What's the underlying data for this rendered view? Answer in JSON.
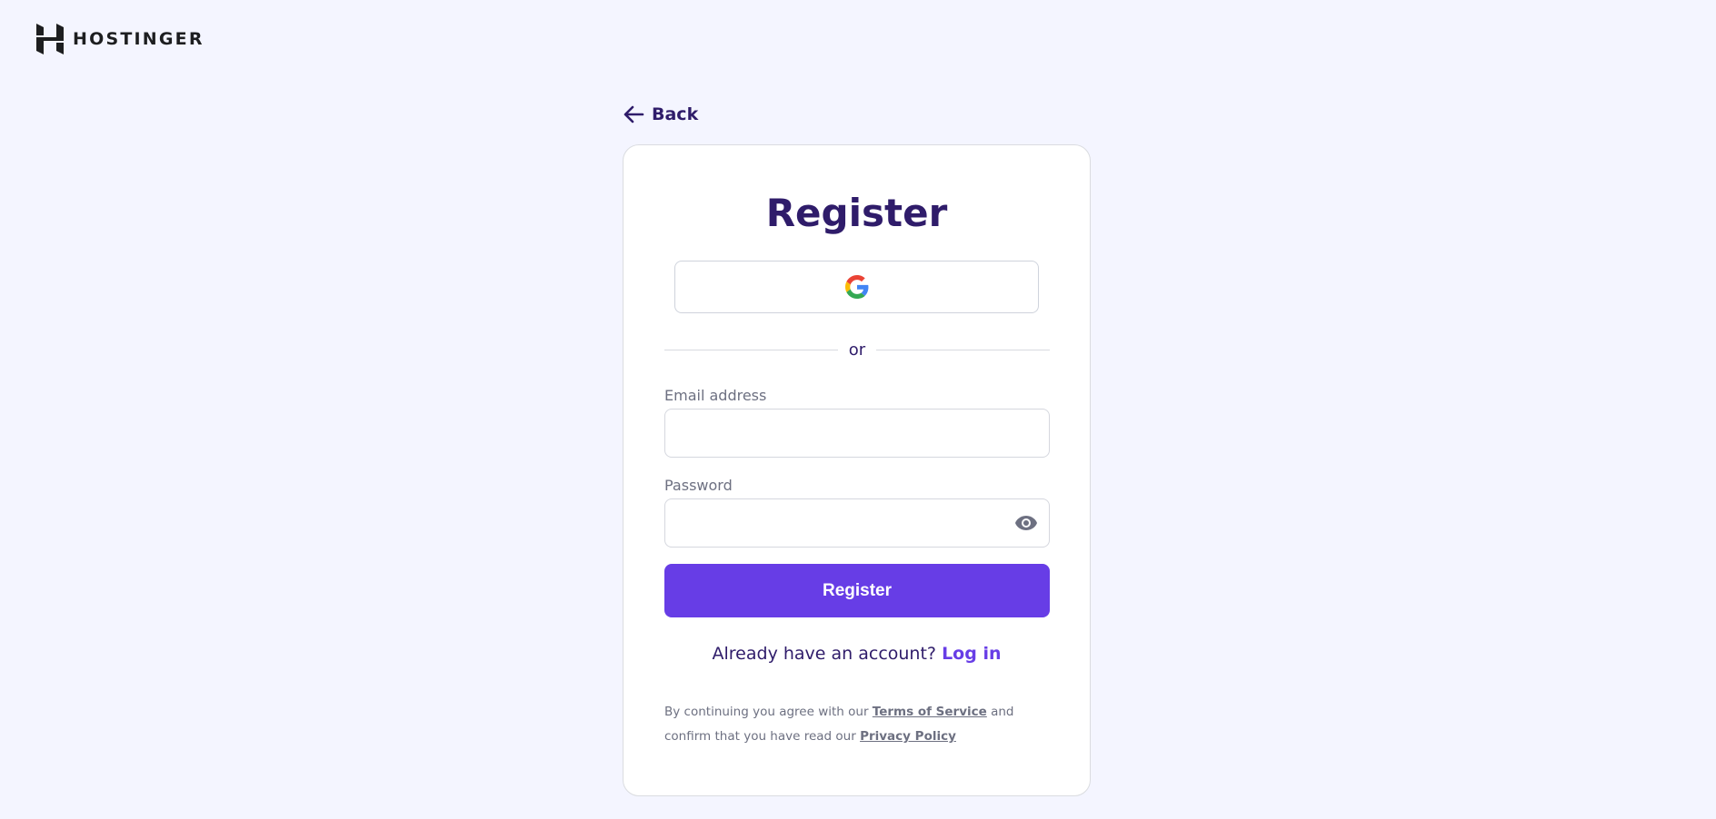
{
  "header": {
    "brand_name": "HOSTINGER",
    "logo_icon": "hostinger-logo-icon"
  },
  "nav": {
    "back_label": "Back",
    "back_icon": "arrow-left-icon"
  },
  "form": {
    "title": "Register",
    "google_icon": "google-icon",
    "divider_text": "or",
    "email_label": "Email address",
    "email_value": "",
    "password_label": "Password",
    "password_value": "",
    "password_toggle_icon": "eye-icon",
    "submit_label": "Register"
  },
  "login": {
    "prompt": "Already have an account? ",
    "link_label": "Log in"
  },
  "legal": {
    "part1": "By continuing you agree with our ",
    "terms_label": "Terms of Service",
    "part2": " and confirm that you have read our ",
    "privacy_label": "Privacy Policy"
  },
  "colors": {
    "background": "#f4f5ff",
    "primary": "#673de6",
    "heading": "#2f1c6a",
    "muted_text": "#6d7081"
  }
}
